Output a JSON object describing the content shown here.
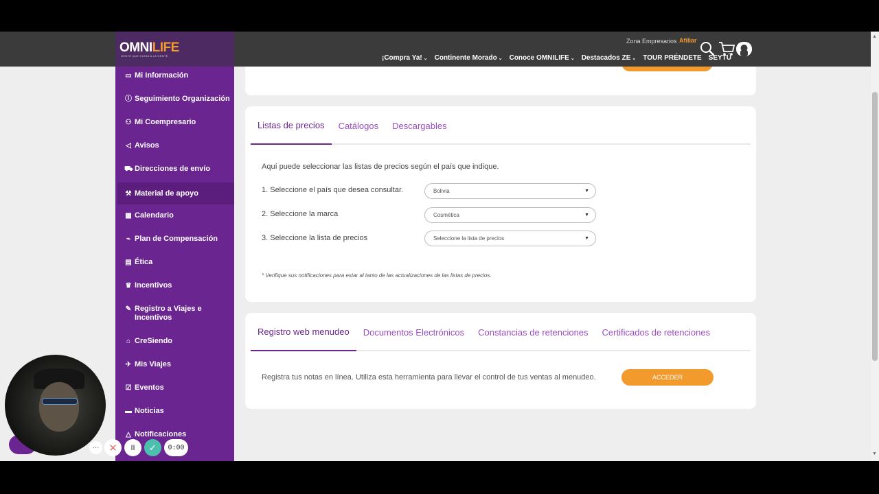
{
  "header": {
    "logo_main": "OMNI",
    "logo_accent": "LIFE",
    "tagline": "GENTE QUE CUIDA A LA GENTE",
    "zona_empresarios": "Zona Empresarios",
    "afiliar": "Afiliar",
    "nav": [
      {
        "label": "¡Compra Ya!",
        "chevron": true
      },
      {
        "label": "Continente Morado",
        "chevron": true
      },
      {
        "label": "Conoce OMNILIFE",
        "chevron": true
      },
      {
        "label": "Destacados ZE",
        "chevron": true
      },
      {
        "label": "TOUR PRÉNDETE",
        "chevron": false
      },
      {
        "label": "SEYTÚ",
        "chevron": false
      }
    ],
    "icons": [
      "search-icon",
      "cart-icon",
      "user-icon"
    ]
  },
  "sidebar": {
    "items": [
      {
        "label": "Mi Información",
        "icon": "id-card-icon",
        "active": false
      },
      {
        "label": "Seguimiento Organización",
        "icon": "info-icon",
        "active": false
      },
      {
        "label": "Mi Coempresario",
        "icon": "user-plus-icon",
        "active": false
      },
      {
        "label": "Avisos",
        "icon": "megaphone-icon",
        "active": false
      },
      {
        "label": "Direcciones de envío",
        "icon": "truck-icon",
        "active": false
      },
      {
        "label": "Material de apoyo",
        "icon": "wrench-icon",
        "active": true
      },
      {
        "label": "Calendario",
        "icon": "calendar-icon",
        "active": false
      },
      {
        "label": "Plan de Compensación",
        "icon": "chart-icon",
        "active": false
      },
      {
        "label": "Ética",
        "icon": "document-icon",
        "active": false
      },
      {
        "label": "Incentivos",
        "icon": "trophy-icon",
        "active": false
      },
      {
        "label": "Registro a Viajes e Incentivos",
        "icon": "edit-icon",
        "active": false
      },
      {
        "label": "CreSiendo",
        "icon": "graduation-icon",
        "active": false
      },
      {
        "label": "Mis Viajes",
        "icon": "plane-icon",
        "active": false
      },
      {
        "label": "Eventos",
        "icon": "calendar-check-icon",
        "active": false
      },
      {
        "label": "Noticias",
        "icon": "newspaper-icon",
        "active": false
      },
      {
        "label": "Notificaciones",
        "icon": "bell-icon",
        "active": false
      }
    ]
  },
  "precios": {
    "tabs": [
      {
        "label": "Listas de precios",
        "active": true
      },
      {
        "label": "Catálogos",
        "active": false
      },
      {
        "label": "Descargables",
        "active": false
      }
    ],
    "intro": "Aquí puede seleccionar las listas de precios según el país que indique.",
    "steps": [
      {
        "label": "1. Seleccione el país que desea consultar.",
        "value": "Bolivia"
      },
      {
        "label": "2. Seleccione la marca",
        "value": "Cosmética"
      },
      {
        "label": "3. Seleccione la lista de precios",
        "value": "Seleccione la lista de precios"
      }
    ],
    "note": "* Verifique sus notificaciones para estar al tanto de las actualizaciones de las listas de precios."
  },
  "registro": {
    "tabs": [
      {
        "label": "Registro web menudeo",
        "active": true
      },
      {
        "label": "Documentos Electrónicos",
        "active": false
      },
      {
        "label": "Constancias de retenciones",
        "active": false
      },
      {
        "label": "Certificados de retenciones",
        "active": false
      }
    ],
    "text": "Registra tus notas en línea. Utiliza esta herramienta para llevar el control de tus ventas al menudeo.",
    "button": "ACCEDER"
  },
  "recorder": {
    "more": "···",
    "cancel": "✕",
    "pause": "II",
    "done": "✓",
    "timer": "0:00"
  },
  "colors": {
    "brand_purple": "#6a2591",
    "accent_orange": "#f39a2d",
    "header_bg": "#3b3b3b"
  }
}
